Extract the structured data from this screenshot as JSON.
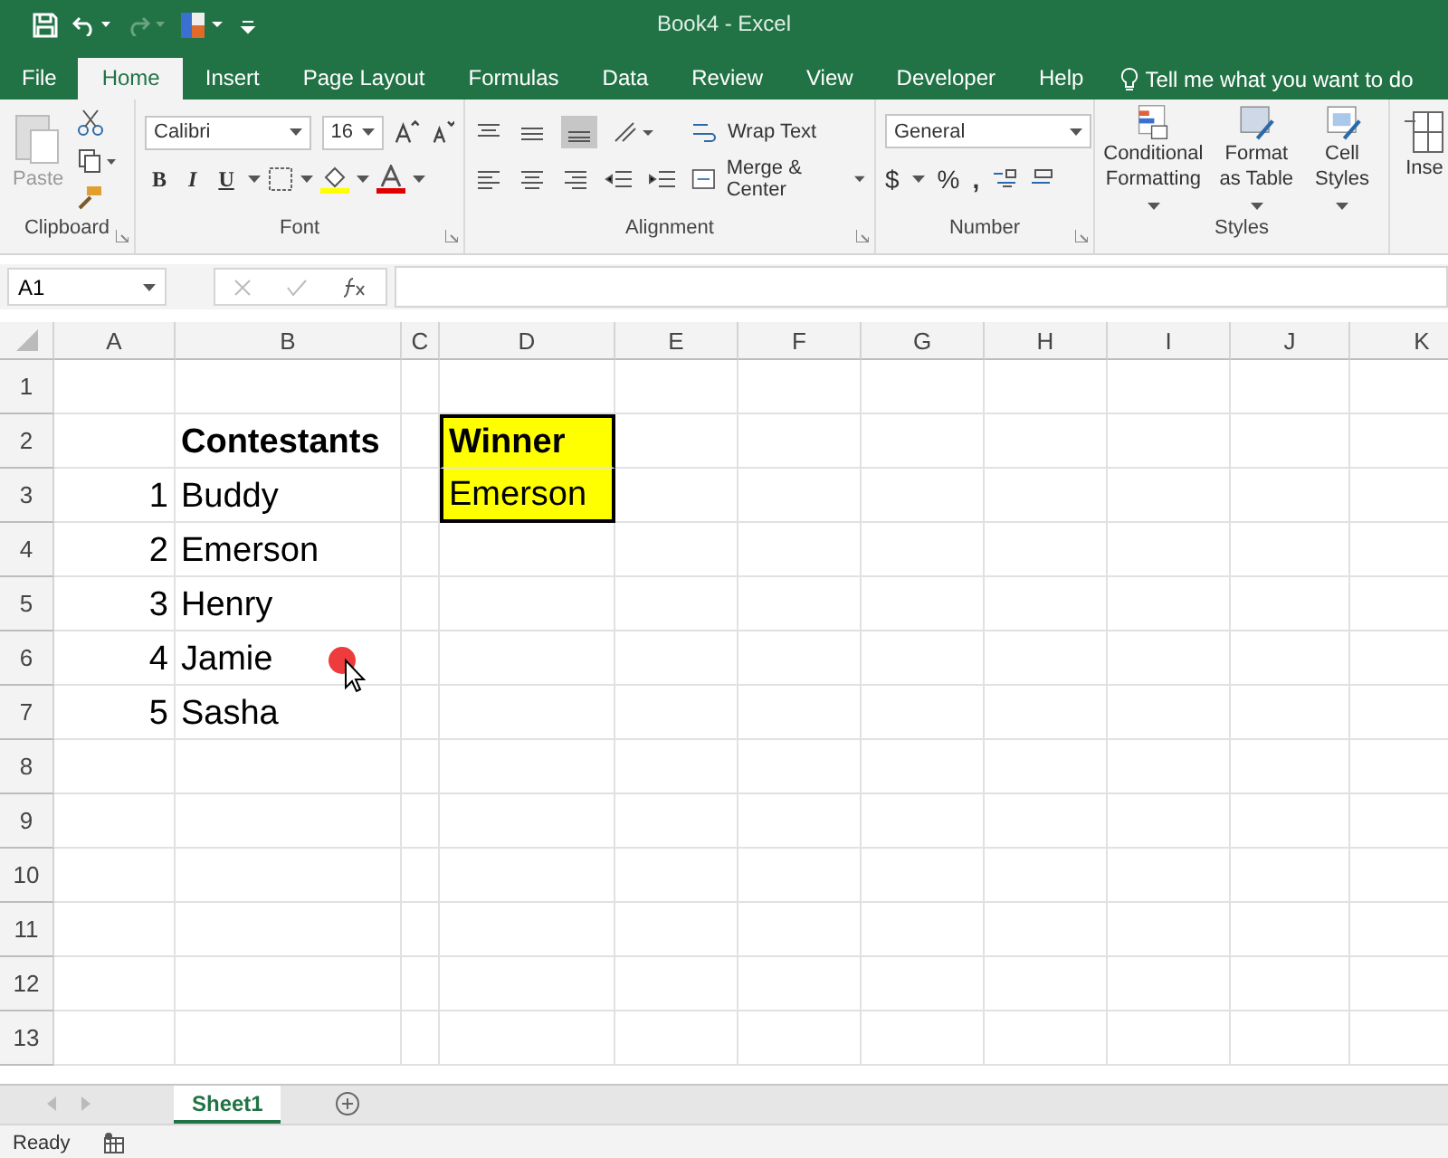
{
  "window": {
    "title": "Book4  -  Excel"
  },
  "tabs": [
    {
      "label": "File",
      "selected": false
    },
    {
      "label": "Home",
      "selected": true
    },
    {
      "label": "Insert",
      "selected": false
    },
    {
      "label": "Page Layout",
      "selected": false
    },
    {
      "label": "Formulas",
      "selected": false
    },
    {
      "label": "Data",
      "selected": false
    },
    {
      "label": "Review",
      "selected": false
    },
    {
      "label": "View",
      "selected": false
    },
    {
      "label": "Developer",
      "selected": false
    },
    {
      "label": "Help",
      "selected": false
    }
  ],
  "tell_me": {
    "placeholder": "Tell me what you want to do"
  },
  "ribbon": {
    "clipboard": {
      "paste": "Paste",
      "label": "Clipboard"
    },
    "font": {
      "name": "Calibri",
      "size": "16",
      "bold": "B",
      "italic": "I",
      "underline": "U",
      "label": "Font"
    },
    "alignment": {
      "wrap_text": "Wrap Text",
      "merge": "Merge & Center",
      "label": "Alignment"
    },
    "number": {
      "format": "General",
      "currency": "$",
      "percent": "%",
      "comma": ",",
      "label": "Number"
    },
    "styles": {
      "items": [
        "Conditional Formatting",
        "Format as Table",
        "Cell Styles"
      ],
      "label": "Styles"
    },
    "cells": {
      "insert": "Inse"
    }
  },
  "name_box": {
    "value": "A1"
  },
  "columns": [
    "A",
    "B",
    "C",
    "D",
    "E",
    "F",
    "G",
    "H",
    "I",
    "J",
    "K"
  ],
  "rows": [
    {
      "header": "1"
    },
    {
      "header": "2",
      "cells": [
        null,
        {
          "text": "Contestants",
          "bold": true
        },
        null,
        {
          "text": "Winner",
          "bold": true,
          "highlighted": true
        }
      ]
    },
    {
      "header": "3",
      "cells": [
        {
          "text": "1",
          "kind": "number"
        },
        {
          "text": "Buddy"
        },
        null,
        {
          "text": "Emerson",
          "highlighted": true
        }
      ]
    },
    {
      "header": "4",
      "cells": [
        {
          "text": "2",
          "kind": "number"
        },
        {
          "text": "Emerson"
        }
      ]
    },
    {
      "header": "5",
      "cells": [
        {
          "text": "3",
          "kind": "number"
        },
        {
          "text": "Henry"
        }
      ]
    },
    {
      "header": "6",
      "cells": [
        {
          "text": "4",
          "kind": "number"
        },
        {
          "text": "Jamie"
        }
      ]
    },
    {
      "header": "7",
      "cells": [
        {
          "text": "5",
          "kind": "number"
        },
        {
          "text": "Sasha"
        }
      ]
    },
    {
      "header": "8"
    },
    {
      "header": "9"
    },
    {
      "header": "10"
    },
    {
      "header": "11"
    },
    {
      "header": "12"
    },
    {
      "header": "13"
    }
  ],
  "sheets": [
    {
      "label": "Sheet1",
      "selected": true
    }
  ],
  "status_bar": {
    "text": "Ready"
  }
}
